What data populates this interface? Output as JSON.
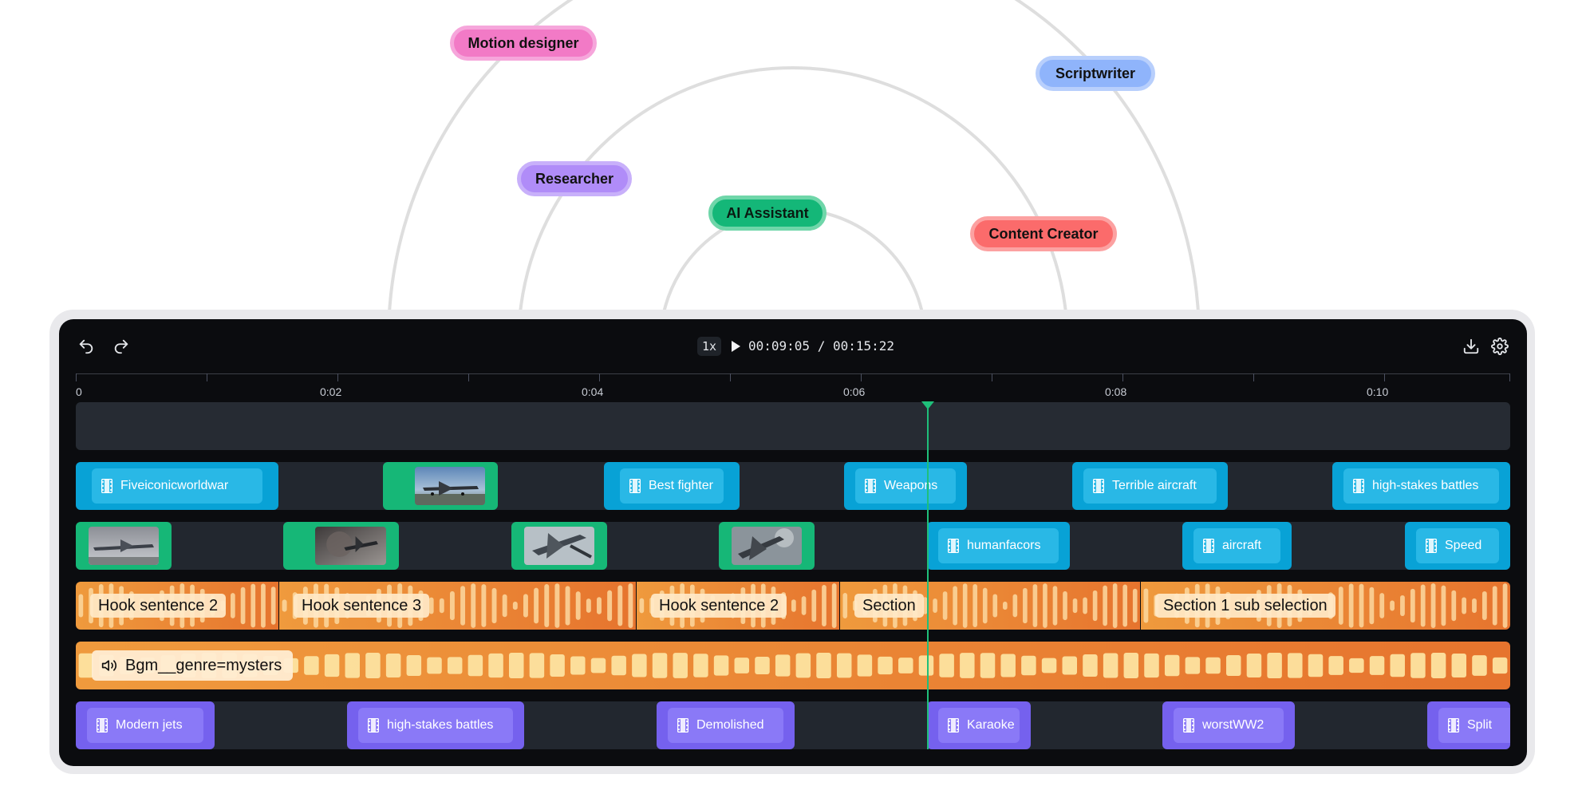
{
  "roles": [
    {
      "label": "Motion designer",
      "color": "#f27ac6"
    },
    {
      "label": "Scriptwriter",
      "color": "#8fb4fb"
    },
    {
      "label": "Researcher",
      "color": "#b08cf8"
    },
    {
      "label": "AI Assistant",
      "color": "#14b778"
    },
    {
      "label": "Content Creator",
      "color": "#fb6b6b"
    }
  ],
  "toolbar": {
    "undo_icon": "undo-icon",
    "redo_icon": "redo-icon",
    "speed": "1x",
    "play_icon": "play-icon",
    "timecode": "00:09:05 / 00:15:22",
    "download_icon": "download-icon",
    "settings_icon": "gear-icon"
  },
  "ruler": {
    "labels": [
      "0",
      "0:02",
      "0:04",
      "0:06",
      "0:08",
      "0:10"
    ]
  },
  "tracks": {
    "video_1": [
      {
        "kind": "text",
        "label": "Fiveiconicworldwar"
      },
      {
        "kind": "image"
      },
      {
        "kind": "text",
        "label": "Best fighter"
      },
      {
        "kind": "text",
        "label": "Weapons"
      },
      {
        "kind": "text",
        "label": "Terrible aircraft"
      },
      {
        "kind": "text",
        "label": "high-stakes battles"
      }
    ],
    "video_2": [
      {
        "kind": "image"
      },
      {
        "kind": "image"
      },
      {
        "kind": "image"
      },
      {
        "kind": "image"
      },
      {
        "kind": "text",
        "label": "humanfacors"
      },
      {
        "kind": "text",
        "label": "aircraft"
      },
      {
        "kind": "text",
        "label": "Speed"
      }
    ],
    "voiceover": [
      {
        "label": "Hook sentence 2"
      },
      {
        "label": "Hook sentence 3"
      },
      {
        "label": "Hook sentence 2"
      },
      {
        "label": "Section"
      },
      {
        "label": "Section 1 sub selection"
      }
    ],
    "music": {
      "label": "Bgm__genre=mysters",
      "icon": "speaker-icon"
    },
    "captions": [
      {
        "label": "Modern jets"
      },
      {
        "label": "high-stakes battles"
      },
      {
        "label": "Demolished"
      },
      {
        "label": "Karaoke"
      },
      {
        "label": "worstWW2"
      },
      {
        "label": "Split"
      }
    ]
  },
  "colors": {
    "accent_green": "#1fbf7a",
    "video_blue": "#08a2d6",
    "image_green": "#16b777",
    "caption_purple": "#7561ee",
    "audio_orange": "#e6742e"
  }
}
